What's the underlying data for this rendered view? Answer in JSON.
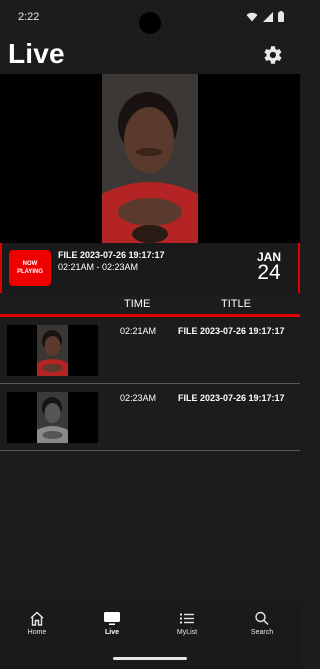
{
  "status_bar": {
    "time": "2:22"
  },
  "header": {
    "title": "Live"
  },
  "now_playing": {
    "badge_line1": "NOW",
    "badge_line2": "PLAYING",
    "title": "FILE 2023-07-26 19:17:17",
    "time_range": "02:21AM - 02:23AM",
    "month": "JAN",
    "day": "24"
  },
  "schedule": {
    "columns": {
      "time": "TIME",
      "title": "TITLE"
    },
    "rows": [
      {
        "time": "02:21AM",
        "title": "FILE 2023-07-26 19:17:17"
      },
      {
        "time": "02:23AM",
        "title": "FILE 2023-07-26 19:17:17"
      }
    ]
  },
  "bottom_nav": {
    "items": [
      {
        "label": "Home",
        "icon": "home-icon"
      },
      {
        "label": "Live",
        "icon": "tv-icon"
      },
      {
        "label": "MyList",
        "icon": "list-icon"
      },
      {
        "label": "Search",
        "icon": "search-icon"
      }
    ],
    "active": "Live"
  },
  "colors": {
    "accent": "#e00000",
    "background": "#1c1c1c"
  }
}
